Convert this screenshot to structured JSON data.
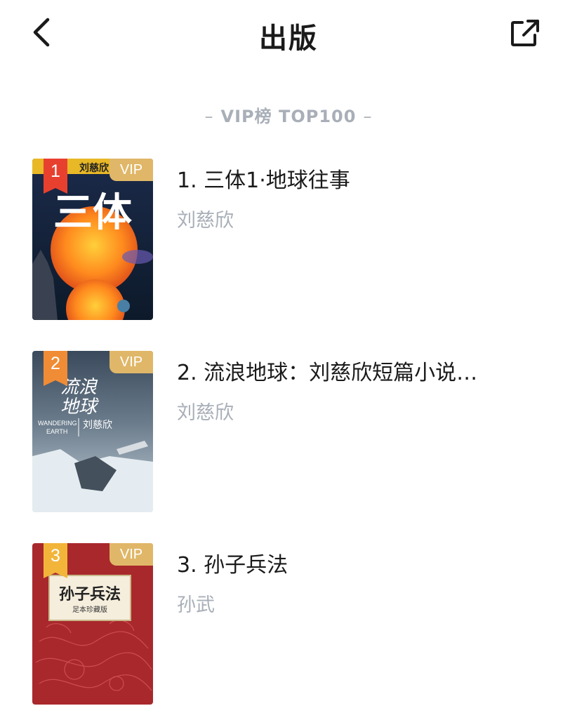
{
  "header": {
    "title": "出版",
    "back_icon": "chevron-left-icon",
    "share_icon": "share-external-icon"
  },
  "section": {
    "heading": "VIP榜 TOP100",
    "dash_left": "–",
    "dash_right": "–"
  },
  "colors": {
    "vip_gold": "#e0b768",
    "rank1": "#e8402f",
    "rank2": "#f08c35",
    "rank3": "#f2b53a",
    "muted_text": "#a9afb8"
  },
  "books": [
    {
      "rank": "1",
      "title": "1. 三体1·地球往事",
      "author": "刘慈欣",
      "vip": "VIP",
      "cover_text": "三体",
      "cover_author": "刘慈欣"
    },
    {
      "rank": "2",
      "title": "2. 流浪地球：刘慈欣短篇小说…",
      "author": "刘慈欣",
      "vip": "VIP",
      "cover_text": "流浪地球",
      "cover_author": "刘慈欣",
      "cover_en": "WANDERING EARTH"
    },
    {
      "rank": "3",
      "title": "3. 孙子兵法",
      "author": "孙武",
      "vip": "VIP",
      "cover_text": "孙子兵法",
      "cover_sub": "足本珍藏版"
    }
  ]
}
